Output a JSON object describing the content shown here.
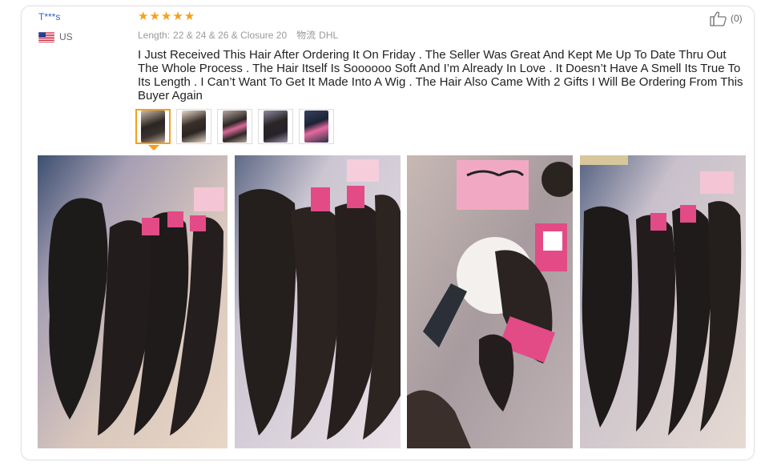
{
  "reviewer": {
    "name": "T***s",
    "country": "US",
    "flag_icon": "us-flag-icon"
  },
  "rating": {
    "stars": 5,
    "max": 5,
    "color": "#f6a01a"
  },
  "product_meta": {
    "length_label": "Length:",
    "length_value": "22 & 24 & 26 & Closure 20",
    "shipping_label": "物流",
    "shipping_value": "DHL"
  },
  "helpful": {
    "icon": "thumbs-up-icon",
    "count": "(0)"
  },
  "review_text": "I Just Received This Hair After Ordering It On Friday . The Seller Was Great And Kept Me Up To Date Thru Out The Whole Process . The Hair Itself Is Soooooo Soft And I’m Already In Love . It Doesn’t Have A Smell Its True To Its Length . I Can’t Want To Get It Made Into A Wig . The Hair Also Came With 2 Gifts I Will Be Ordering From This Buyer Again",
  "thumbnails": [
    {
      "active": true
    },
    {
      "active": false
    },
    {
      "active": false
    },
    {
      "active": false
    },
    {
      "active": false
    }
  ],
  "photos": [
    {
      "subject": "curly hair bundles with closure"
    },
    {
      "subject": "curly hair bundles on bed"
    },
    {
      "subject": "hair packaging with eyelash gift"
    },
    {
      "subject": "curly hair bundles with closure"
    }
  ],
  "colors": {
    "accent": "#f6a01a",
    "username": "#2f62c7",
    "text": "#222222"
  }
}
